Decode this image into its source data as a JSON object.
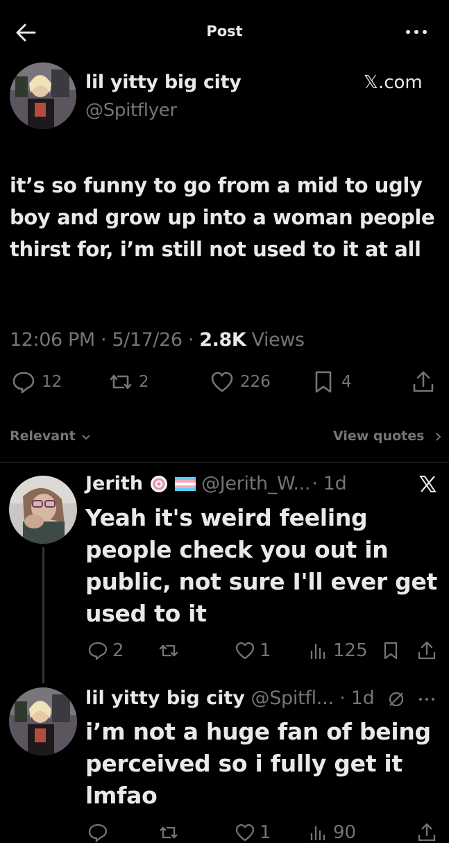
{
  "header": {
    "title": "Post"
  },
  "post": {
    "display_name": "lil yitty big city",
    "handle": "@Spitflyer",
    "source": "𝕏.com",
    "text": "it’s so funny to go from a mid to ugly boy and grow up into a woman people thirst for, i’m still not used to it at all",
    "time": "12:06 PM",
    "date": "5/17/26",
    "views_count": "2.8K",
    "views_label": "Views",
    "replies": "12",
    "reposts": "2",
    "likes": "226",
    "bookmarks": "4"
  },
  "sort": {
    "label": "Relevant",
    "view_quotes": "View quotes"
  },
  "replies": [
    {
      "name": "Jerith",
      "handle": "@Jerith_W...",
      "age": "· 1d",
      "text": "Yeah it's weird feeling people check you out in public, not sure I'll ever get used to it",
      "replies": "2",
      "likes": "1",
      "views": "125"
    },
    {
      "name": "lil yitty big city",
      "handle": "@Spitfl...",
      "age": "· 1d",
      "text": "i’m not a huge fan of being perceived so i fully get it lmfao",
      "likes": "1",
      "views": "90"
    }
  ],
  "colors": {
    "background": "#000000",
    "text": "#e7e9ea",
    "muted": "#71767b",
    "divider": "#2f3336"
  }
}
